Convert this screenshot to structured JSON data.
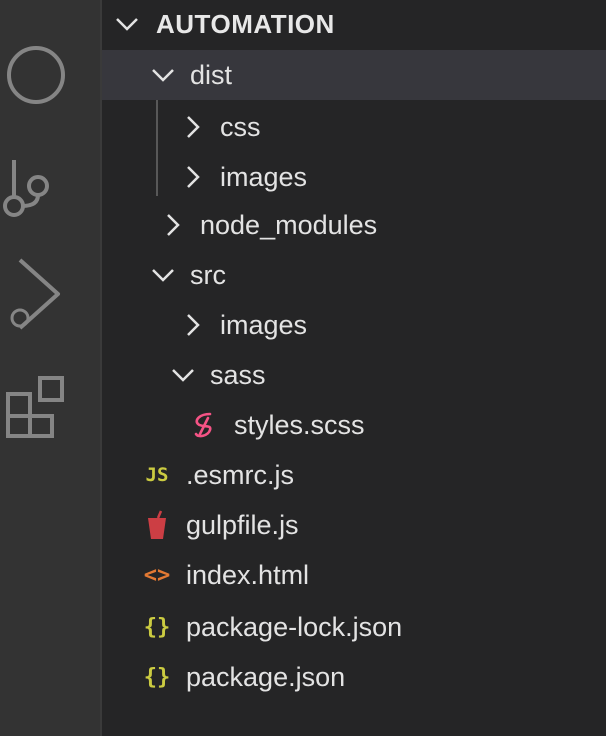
{
  "explorer": {
    "section_title": "AUTOMATION",
    "items": [
      {
        "label": "dist",
        "type": "folder",
        "expanded": true,
        "selected": true
      },
      {
        "label": "css",
        "type": "folder",
        "expanded": false
      },
      {
        "label": "images",
        "type": "folder",
        "expanded": false
      },
      {
        "label": "node_modules",
        "type": "folder",
        "expanded": false
      },
      {
        "label": "src",
        "type": "folder",
        "expanded": true
      },
      {
        "label": "images",
        "type": "folder",
        "expanded": false
      },
      {
        "label": "sass",
        "type": "folder",
        "expanded": true
      },
      {
        "label": "styles.scss",
        "type": "file",
        "icon": "sass-icon"
      },
      {
        "label": ".esmrc.js",
        "type": "file",
        "icon": "js-icon",
        "icon_text": "JS"
      },
      {
        "label": "gulpfile.js",
        "type": "file",
        "icon": "gulp-icon"
      },
      {
        "label": "index.html",
        "type": "file",
        "icon": "html-icon",
        "icon_text": "<>"
      },
      {
        "label": "package-lock.json",
        "type": "file",
        "icon": "json-icon",
        "icon_text": "{}"
      },
      {
        "label": "package.json",
        "type": "file",
        "icon": "json-icon",
        "icon_text": "{}"
      }
    ]
  },
  "activity_bar": {
    "icons": [
      "search-icon",
      "source-control-icon",
      "run-debug-icon",
      "extensions-icon"
    ]
  },
  "colors": {
    "sidebar_bg": "#252526",
    "activity_bg": "#333333",
    "selected_row": "#37373d",
    "js_yellow": "#cbcb41",
    "json_yellow": "#cbcb41",
    "html_orange": "#e37933",
    "sass_pink": "#f55385",
    "gulp_red": "#cc3e44"
  }
}
